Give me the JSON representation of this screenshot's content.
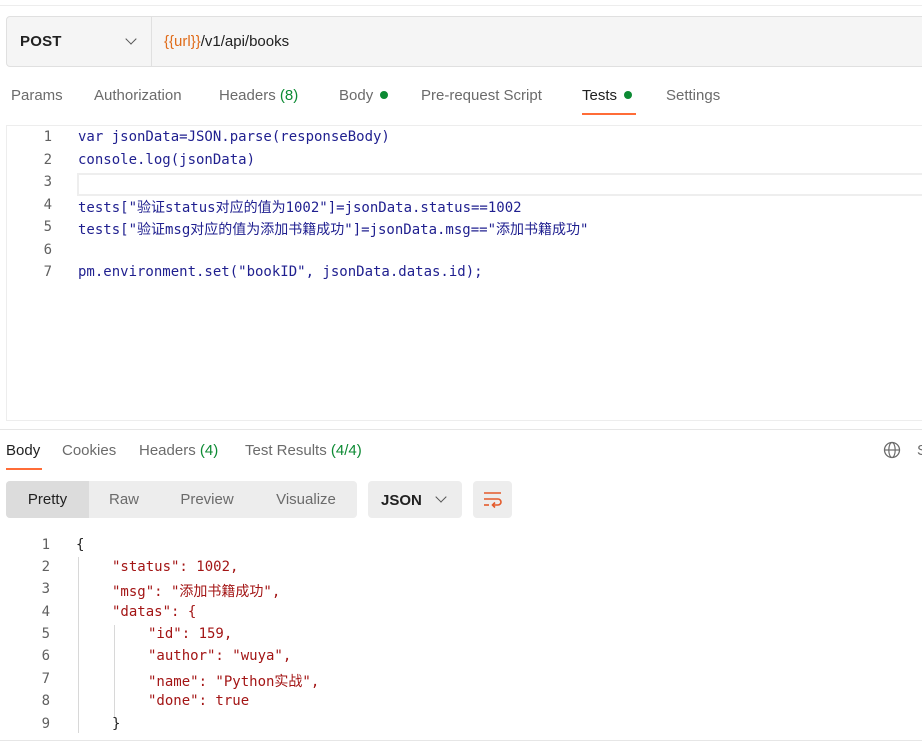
{
  "request": {
    "method": "POST",
    "url_var": "{{url}}",
    "url_path": "/v1/api/books"
  },
  "request_tabs": [
    {
      "label": "Params"
    },
    {
      "label": "Authorization"
    },
    {
      "label": "Headers",
      "count": "(8)"
    },
    {
      "label": "Body"
    },
    {
      "label": "Pre-request Script"
    },
    {
      "label": "Tests"
    },
    {
      "label": "Settings"
    }
  ],
  "tests_script": {
    "line_numbers": [
      "1",
      "2",
      "3",
      "4",
      "5",
      "6",
      "7"
    ],
    "lines": [
      "var jsonData=JSON.parse(responseBody)",
      "console.log(jsonData)",
      "",
      "tests[\"验证status对应的值为1002\"]=jsonData.status==1002",
      "tests[\"验证msg对应的值为添加书籍成功\"]=jsonData.msg==\"添加书籍成功\"",
      "",
      "pm.environment.set(\"bookID\", jsonData.datas.id);"
    ]
  },
  "response_tabs": [
    {
      "label": "Body"
    },
    {
      "label": "Cookies"
    },
    {
      "label": "Headers",
      "count": "(4)"
    },
    {
      "label": "Test Results",
      "count": "(4/4)"
    }
  ],
  "response_cut_label": "S",
  "view_modes": [
    "Pretty",
    "Raw",
    "Preview",
    "Visualize"
  ],
  "format": "JSON",
  "response_body": {
    "line_numbers": [
      "1",
      "2",
      "3",
      "4",
      "5",
      "6",
      "7",
      "8",
      "9"
    ],
    "lines": [
      "{",
      "\"status\": 1002,",
      "\"msg\": \"添加书籍成功\",",
      "\"datas\": {",
      "\"id\": 159,",
      "\"author\": \"wuya\",",
      "\"name\": \"Python实战\",",
      "\"done\": true",
      "}"
    ]
  },
  "colors": {
    "accent": "#ff6c37",
    "success": "#0c8a33",
    "variable": "#e06c1a"
  }
}
